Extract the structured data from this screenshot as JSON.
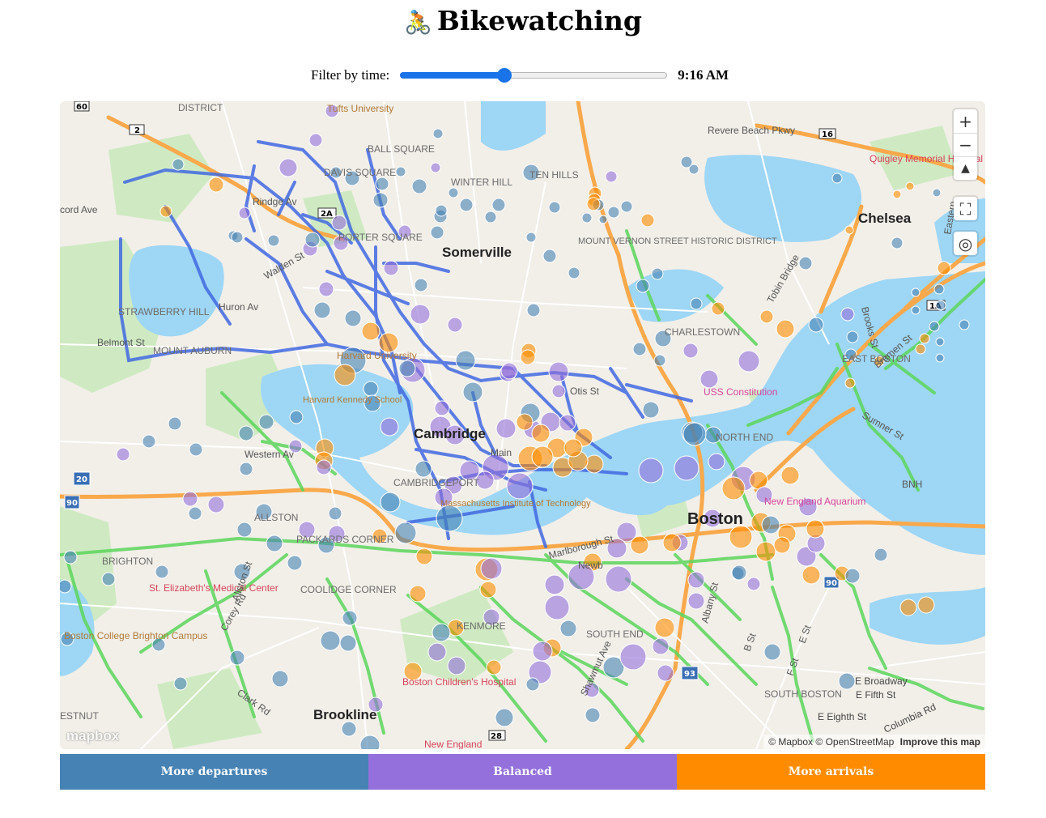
{
  "header": {
    "title": "Bikewatching",
    "icon": "🚴"
  },
  "filter": {
    "label": "Filter by time:",
    "time": "9:16 AM",
    "slider_fraction": 0.39
  },
  "map": {
    "labels": {
      "somerville": "Somerville",
      "cambridge": "Cambridge",
      "boston": "Boston",
      "brookline": "Brookline",
      "chelsea": "Chelsea",
      "charlestown": "CHARLESTOWN",
      "allston": "ALLSTON",
      "brighton": "BRIGHTON",
      "south_boston": "SOUTH BOSTON",
      "east_boston": "EAST BOSTON",
      "north_end": "NORTH END",
      "kenmore": "KENMORE",
      "south_end": "SOUTH END",
      "harvard": "Harvard University",
      "tufts": "Tufts University",
      "mit": "Massachusetts Institute of Technology",
      "davis": "DAVIS SQUARE",
      "porter": "PORTER SQUARE",
      "ball_square": "BALL SQUARE",
      "winter_hill": "WINTER HILL",
      "ten_hills": "TEN HILLS",
      "mount_vernon": "MOUNT VERNON STREET HISTORIC DISTRICT",
      "strawberry_hill": "STRAWBERRY HILL",
      "mount_auburn": "MOUNT AUBURN",
      "cambridgeport": "CAMBRIDGEPORT",
      "packards": "PACKARDS CORNER",
      "coolidge": "COOLIDGE CORNER",
      "quigley": "Quigley Memorial Hospital",
      "st_elizabeth": "St. Elizabeth's Medical Center",
      "bc": "Boston College Brighton Campus",
      "childrens": "Boston Children's Hospital",
      "new_england": "New England",
      "uss": "USS Constitution",
      "aquarium": "New England Aquarium",
      "harvard_kennedy": "Harvard Kennedy School",
      "district": "DISTRICT",
      "estnut": "ESTNUT",
      "revere_beach": "Revere Beach Pkwy",
      "tobin": "Tobin Bridge",
      "western_av": "Western Av",
      "huron_av": "Huron Av",
      "walden_st": "Walden St",
      "rindge_av": "Rindge Av",
      "belmont_st": "Belmont St",
      "concord_ave": "cord Ave",
      "marlborough": "Marlborough St",
      "newbury": "Newb",
      "broadway": "E Broadway",
      "fifth": "E Fifth St",
      "eighth": "E Eighth St",
      "columbia": "Columbia Rd",
      "allston_st": "Allston St",
      "corey_rd": "Corey Rd",
      "clark_rd": "Clark Rd",
      "sumner": "Sumner St",
      "brooks": "Brooks St",
      "bremen": "Bremen St",
      "shawmut": "Shawmut Ave",
      "albany": "Albany St",
      "b_st": "B St",
      "e_st": "E St",
      "f_st": "F St",
      "main": "Main",
      "otis": "Otis St",
      "bnh": "BNH",
      "eastern": "Eastern"
    },
    "shields": [
      "60",
      "2",
      "16",
      "1A",
      "20",
      "90",
      "93",
      "28",
      "90",
      "2A"
    ],
    "attribution": {
      "mapbox": "© Mapbox",
      "osm": "© OpenStreetMap",
      "improve": "Improve this map"
    },
    "logo": "mapbox",
    "controls": {
      "zoom_in": "+",
      "zoom_out": "−",
      "compass": "▲",
      "fullscreen": "⛶",
      "locate": "◎"
    }
  },
  "legend": {
    "departures": "More departures",
    "balanced": "Balanced",
    "arrivals": "More arrivals"
  },
  "colors": {
    "departures": "#4682b4",
    "balanced": "#9370db",
    "arrivals": "#ff8c00",
    "water": "#9ed6f5",
    "park": "#cfeac2",
    "bike_cambridge": "#4169e1",
    "bike_boston": "#5cd65c",
    "highway": "#f9a94b"
  }
}
